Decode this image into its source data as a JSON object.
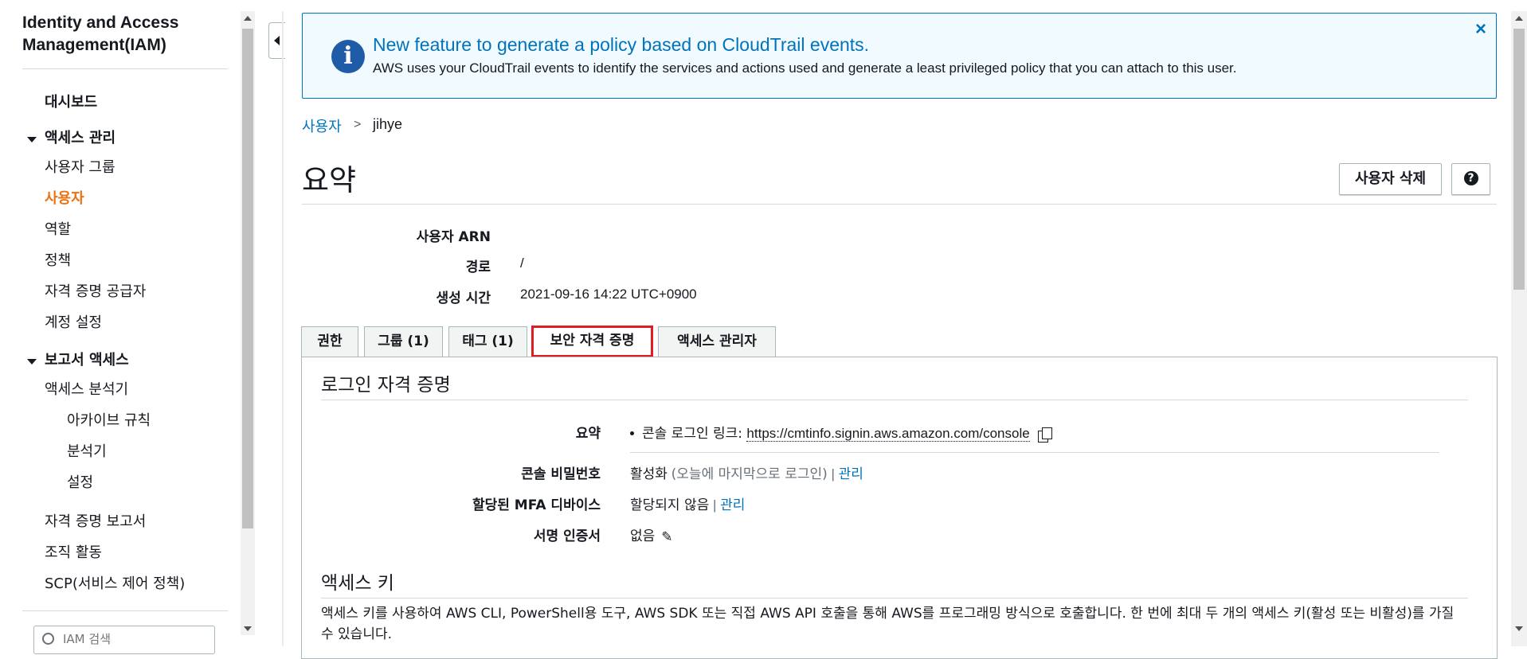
{
  "sidebar": {
    "title": "Identity and Access Management(IAM)",
    "dashboard": "대시보드",
    "access_mgmt": {
      "label": "액세스 관리",
      "items": [
        "사용자 그룹",
        "사용자",
        "역할",
        "정책",
        "자격 증명 공급자",
        "계정 설정"
      ],
      "active": "사용자"
    },
    "report_access": {
      "label": "보고서 액세스",
      "analyzer": "액세스 분석기",
      "sub_items": [
        "아카이브 규칙",
        "분석기",
        "설정"
      ],
      "more_items": [
        "자격 증명 보고서",
        "조직 활동",
        "SCP(서비스 제어 정책)"
      ]
    },
    "search_placeholder": "IAM 검색"
  },
  "banner": {
    "title": "New feature to generate a policy based on CloudTrail events.",
    "text": "AWS uses your CloudTrail events to identify the services and actions used and generate a least privileged policy that you can attach to this user.",
    "close": "×",
    "icon": "info-icon"
  },
  "breadcrumb": {
    "parent": "사용자",
    "separator": ">",
    "current": "jihye"
  },
  "page_title": "요약",
  "buttons": {
    "delete_user": "사용자 삭제",
    "help": "?"
  },
  "summary": {
    "arn_label": "사용자 ARN",
    "arn_value": "",
    "path_label": "경로",
    "path_value": "/",
    "created_label": "생성 시간",
    "created_value": "2021-09-16 14:22 UTC+0900"
  },
  "tabs": [
    {
      "label": "권한"
    },
    {
      "label": "그룹 (1)"
    },
    {
      "label": "태그 (1)"
    },
    {
      "label": "보안 자격 증명"
    },
    {
      "label": "액세스 관리자"
    }
  ],
  "active_tab": "보안 자격 증명",
  "signin": {
    "heading": "로그인 자격 증명",
    "summary_label": "요약",
    "console_link_prefix": "콘솔 로그인 링크: ",
    "console_link_url": "https://cmtinfo.signin.aws.amazon.com/console",
    "console_password_label": "콘솔 비밀번호",
    "console_password_status": "활성화",
    "console_password_note": "(오늘에 마지막으로 로그인)",
    "manage": "관리",
    "divider": "|",
    "mfa_label": "할당된 MFA 디바이스",
    "mfa_status": "할당되지 않음",
    "cert_label": "서명 인증서",
    "cert_value": "없음"
  },
  "access_keys": {
    "heading": "액세스 키",
    "description": "액세스 키를 사용하여 AWS CLI, PowerShell용 도구, AWS SDK 또는 직접 AWS API 호출을 통해 AWS를 프로그래밍 방식으로 호출합니다. 한 번에 최대 두 개의 액세스 키(활성 또는 비활성)를 가질 수 있습니다."
  },
  "colors": {
    "link": "#0073bb",
    "active_nav": "#ec7211",
    "highlight": "#e11d24",
    "banner_bg": "#f1faff"
  }
}
